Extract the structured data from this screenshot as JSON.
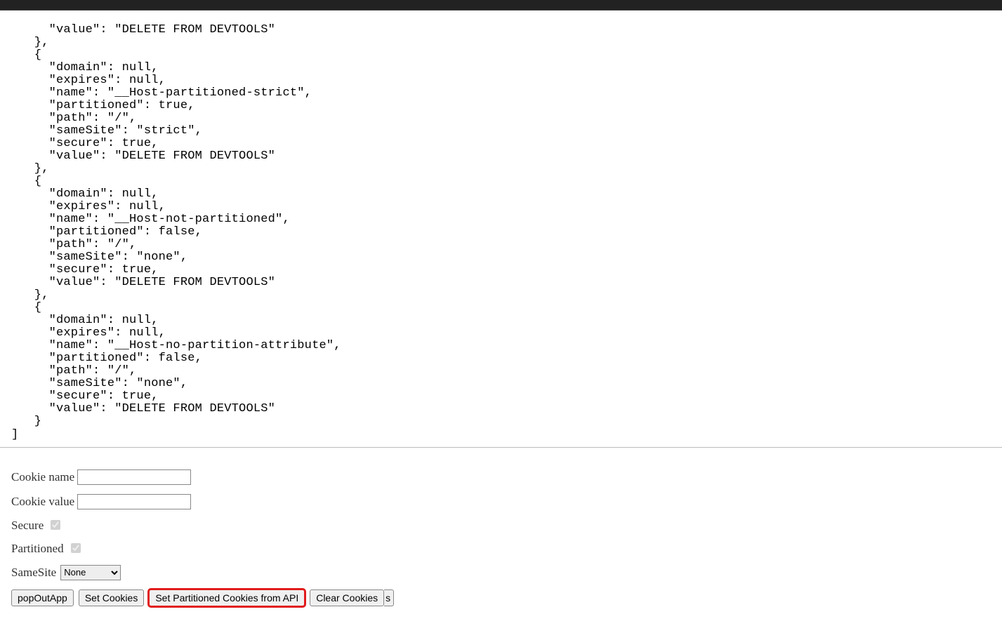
{
  "json_dump": {
    "line0": "    \"value\": \"DELETE FROM DEVTOOLS\"",
    "line1": "  },",
    "line2": "  {",
    "line3": "    \"domain\": null,",
    "line4": "    \"expires\": null,",
    "line5": "    \"name\": \"__Host-partitioned-strict\",",
    "line6": "    \"partitioned\": true,",
    "line7": "    \"path\": \"/\",",
    "line8": "    \"sameSite\": \"strict\",",
    "line9": "    \"secure\": true,",
    "line10": "    \"value\": \"DELETE FROM DEVTOOLS\"",
    "line11": "  },",
    "line12": "  {",
    "line13": "    \"domain\": null,",
    "line14": "    \"expires\": null,",
    "line15": "    \"name\": \"__Host-not-partitioned\",",
    "line16": "    \"partitioned\": false,",
    "line17": "    \"path\": \"/\",",
    "line18": "    \"sameSite\": \"none\",",
    "line19": "    \"secure\": true,",
    "line20": "    \"value\": \"DELETE FROM DEVTOOLS\"",
    "line21": "  },",
    "line22": "  {",
    "line23": "    \"domain\": null,",
    "line24": "    \"expires\": null,",
    "line25": "    \"name\": \"__Host-no-partition-attribute\",",
    "line26": "    \"partitioned\": false,",
    "line27": "    \"path\": \"/\",",
    "line28": "    \"sameSite\": \"none\",",
    "line29": "    \"secure\": true,",
    "line30": "    \"value\": \"DELETE FROM DEVTOOLS\"",
    "line31": "  }",
    "line32": "]"
  },
  "form": {
    "cookie_name_label": "Cookie name",
    "cookie_name_value": "",
    "cookie_value_label": "Cookie value",
    "cookie_value_value": "",
    "secure_label": "Secure",
    "partitioned_label": "Partitioned",
    "samesite_label": "SameSite",
    "samesite_selected": "None"
  },
  "buttons": {
    "popout": "popOutApp",
    "set_cookies": "Set  Cookies",
    "set_partitioned": "Set Partitioned Cookies from API",
    "clear_cookies": "Clear Cookies",
    "partial": "s"
  }
}
